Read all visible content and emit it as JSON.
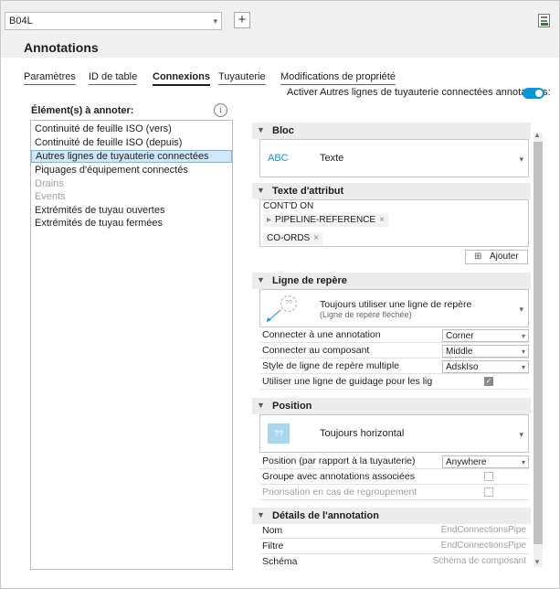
{
  "header": {
    "dropdown_value": "B04L",
    "add_label": "+",
    "title": "Annotations"
  },
  "tabs": [
    {
      "label": "Paramètres"
    },
    {
      "label": "ID de table"
    },
    {
      "label": "Connexions"
    },
    {
      "label": "Tuyauterie"
    },
    {
      "label": "Modifications de propriété"
    }
  ],
  "active_tab": "Connexions",
  "activer_label": "Activer Autres lignes de tuyauterie connectées annotations:",
  "activer_on": true,
  "left": {
    "heading": "Élément(s) à annoter:",
    "info": "i",
    "items": [
      {
        "label": "Continuité de feuille ISO (vers)"
      },
      {
        "label": "Continuité de feuille ISO (depuis)"
      },
      {
        "label": "Autres lignes de tuyauterie connectées"
      },
      {
        "label": "Piquages d'équipement connectés"
      },
      {
        "label": "Drains"
      },
      {
        "label": "Events"
      },
      {
        "label": "Extrémités de tuyau ouvertes"
      },
      {
        "label": "Extrémités de tuyau fermées"
      }
    ],
    "selected": "Autres lignes de tuyauterie connectées"
  },
  "panel": {
    "bloc": {
      "title": "Bloc",
      "preview": "ABC",
      "value": "Texte"
    },
    "texte_attribut": {
      "title": "Texte d'attribut",
      "line1": "CONT'D ON",
      "chip1": "PIPELINE-REFERENCE",
      "chip2": "CO-ORDS",
      "chip_close": "×",
      "expand_glyph": "▸",
      "add_label": "Ajouter"
    },
    "ligne_repere": {
      "title": "Ligne de repère",
      "preview_glyph": "??",
      "option": "Toujours utiliser une ligne de repère",
      "option_sub": "(Ligne de repère fléchée)",
      "rows": [
        {
          "label": "Connecter à une annotation",
          "value": "Corner"
        },
        {
          "label": "Connecter au composant",
          "value": "Middle"
        },
        {
          "label": "Style de ligne de repère multiple",
          "value": "AdskIso"
        },
        {
          "label": "Utiliser une ligne de guidage pour les lignes",
          "checked": true
        }
      ]
    },
    "position": {
      "title": "Position",
      "preview_glyph": "??",
      "option": "Toujours horizontal",
      "rows": [
        {
          "label": "Position (par rapport à la tuyauterie)",
          "value": "Anywhere"
        },
        {
          "label": "Groupe avec annotations associées",
          "checked": false
        },
        {
          "label": "Priorisation en cas de regroupement",
          "checked": false,
          "disabled": true
        }
      ]
    },
    "details": {
      "title": "Détails de l'annotation",
      "rows": [
        {
          "label": "Nom",
          "value": "EndConnectionsPipe"
        },
        {
          "label": "Filtre",
          "value": "EndConnectionsPipe"
        },
        {
          "label": "Schéma",
          "value": "Schéma de composant"
        }
      ]
    }
  },
  "icons": {
    "caret": "▼",
    "dropdown": "▾",
    "scroll_up": "▲",
    "scroll_down": "▼",
    "check": "✓"
  },
  "colors": {
    "accent": "#0696d7",
    "selection": "#cfe8fc",
    "section_bg": "#ececec"
  }
}
